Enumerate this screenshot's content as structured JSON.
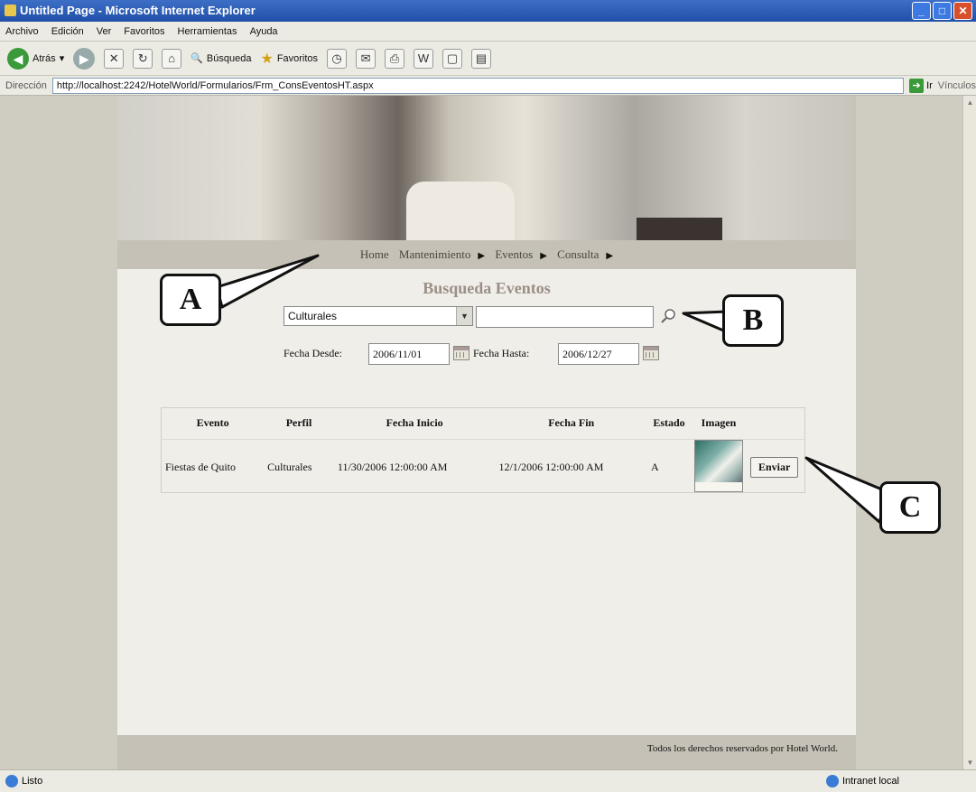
{
  "window": {
    "title": "Untitled Page - Microsoft Internet Explorer"
  },
  "menubar": [
    "Archivo",
    "Edición",
    "Ver",
    "Favoritos",
    "Herramientas",
    "Ayuda"
  ],
  "toolbar": {
    "back_label": "Atrás",
    "search_label": "Búsqueda",
    "favorites_label": "Favoritos"
  },
  "address": {
    "label": "Dirección",
    "url": "http://localhost:2242/HotelWorld/Formularios/Frm_ConsEventosHT.aspx",
    "go_label": "Ir",
    "links_label": "Vínculos"
  },
  "nav": {
    "home": "Home",
    "maintenance": "Mantenimiento",
    "events": "Eventos",
    "query": "Consulta"
  },
  "search": {
    "title": "Busqueda Eventos",
    "category_value": "Culturales",
    "text_value": "",
    "from_label": "Fecha Desde:",
    "from_value": "2006/11/01",
    "to_label": "Fecha Hasta:",
    "to_value": "2006/12/27"
  },
  "results": {
    "columns": [
      "Evento",
      "Perfil",
      "Fecha Inicio",
      "Fecha Fin",
      "Estado",
      "Imagen"
    ],
    "rows": [
      {
        "evento": "Fiestas de Quito",
        "perfil": "Culturales",
        "inicio": "11/30/2006 12:00:00 AM",
        "fin": "12/1/2006 12:00:00 AM",
        "estado": "A",
        "button": "Enviar"
      }
    ]
  },
  "footer": {
    "text": "Todos los derechos reservados por Hotel World."
  },
  "status": {
    "left": "Listo",
    "zone": "Intranet local"
  },
  "callouts": {
    "a": "A",
    "b": "B",
    "c": "C"
  }
}
